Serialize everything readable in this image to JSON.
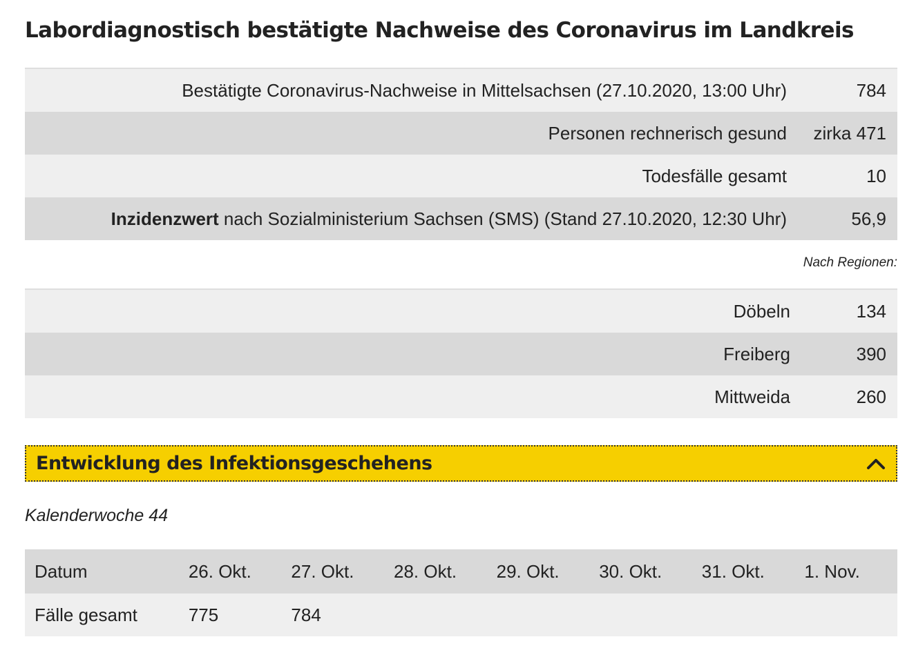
{
  "title": "Labordiagnostisch bestätigte Nachweise des Coronavirus im Landkreis",
  "stats": [
    {
      "label_bold": "",
      "label": "Bestätigte Coronavirus-Nachweise in Mittelsachsen (27.10.2020, 13:00 Uhr)",
      "value": "784"
    },
    {
      "label_bold": "",
      "label": "Personen rechnerisch gesund",
      "value": "zirka 471"
    },
    {
      "label_bold": "",
      "label": "Todesfälle gesamt",
      "value": "10"
    },
    {
      "label_bold": "Inzidenzwert",
      "label": " nach Sozialministerium Sachsen (SMS) (Stand 27.10.2020, 12:30 Uhr)",
      "value": "56,9"
    }
  ],
  "regions_caption": "Nach Regionen:",
  "regions": [
    {
      "label": "Döbeln",
      "value": "134"
    },
    {
      "label": "Freiberg",
      "value": "390"
    },
    {
      "label": "Mittweida",
      "value": "260"
    }
  ],
  "accordion": {
    "title": "Entwicklung des Infektionsgeschehens",
    "icon": "chevron-up-icon",
    "color": "#f6cf00"
  },
  "week": {
    "caption": "Kalenderwoche 44",
    "header_label": "Datum",
    "days": [
      "26. Okt.",
      "27. Okt.",
      "28. Okt.",
      "29. Okt.",
      "30. Okt.",
      "31. Okt.",
      "1. Nov."
    ],
    "row_label": "Fälle gesamt",
    "values": [
      "775",
      "784",
      "",
      "",
      "",
      "",
      ""
    ]
  }
}
